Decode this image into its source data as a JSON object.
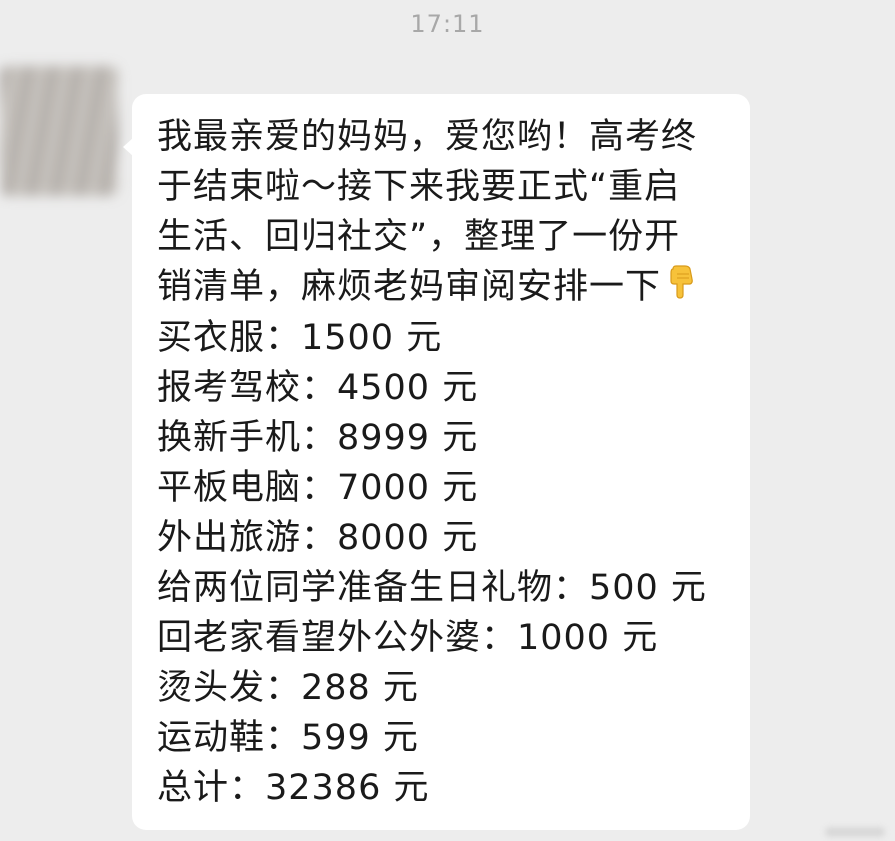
{
  "header": {
    "timestamp": "17:11"
  },
  "message": {
    "sender_avatar": "blurred-avatar",
    "intro_lines": [
      "我最亲爱的妈妈，爱您哟！高考终",
      "于结束啦～接下来我要正式“重启",
      "生活、回归社交”，整理了一份开",
      "销清单，麻烦老妈审阅安排一下"
    ],
    "intro_emoji": "pointing-down-hand",
    "items": [
      "买衣服：1500 元",
      "报考驾校：4500 元",
      "换新手机：8999 元",
      "平板电脑：7000 元",
      "外出旅游：8000 元",
      "给两位同学准备生日礼物：500 元",
      "回老家看望外公外婆：1000 元",
      "烫头发：288 元",
      "运动鞋：599 元",
      "总计：32386 元"
    ]
  },
  "colors": {
    "background": "#ededed",
    "bubble": "#ffffff",
    "text": "#1a1a1a",
    "timestamp": "#a8a8a8"
  }
}
